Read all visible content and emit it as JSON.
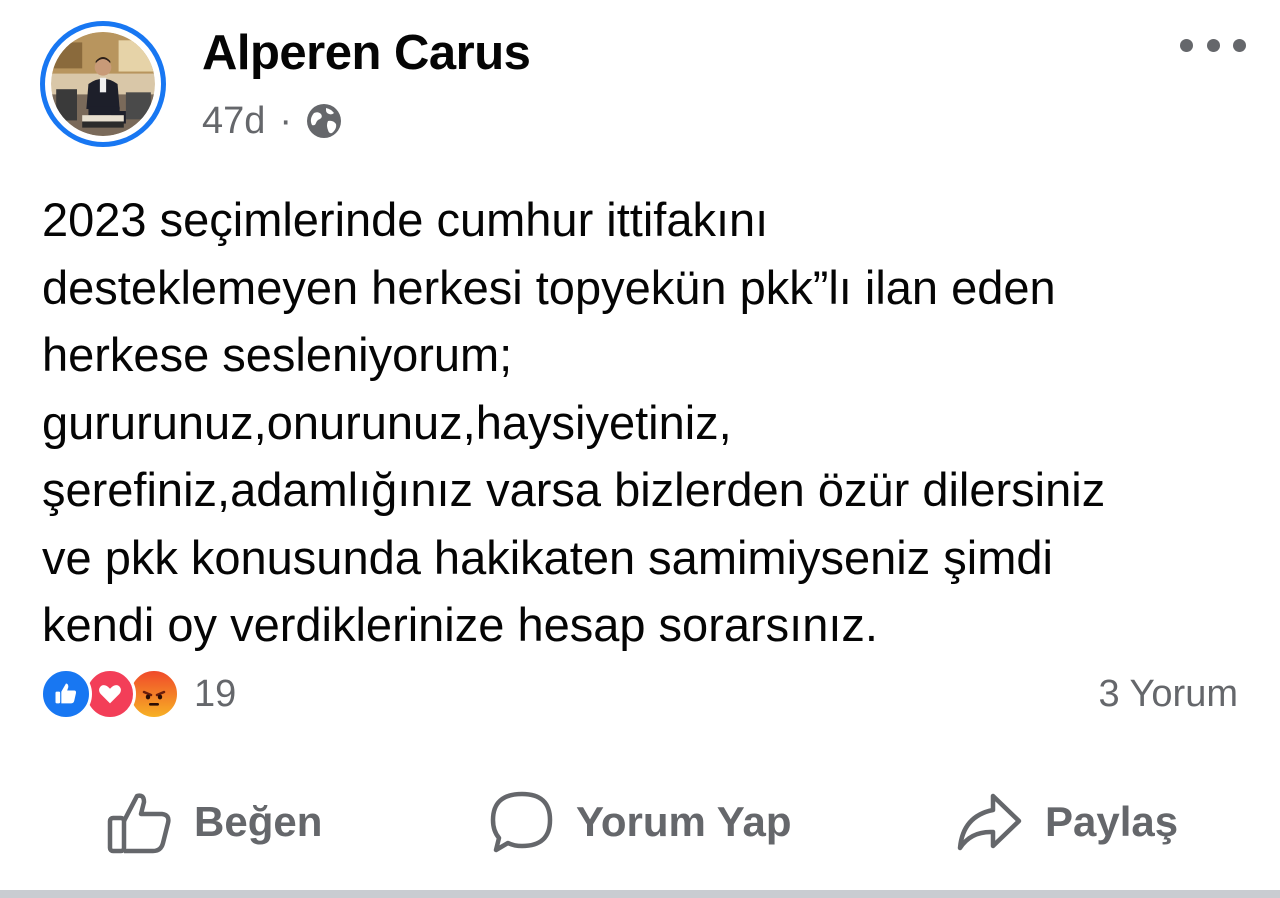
{
  "post": {
    "author": "Alperen Carus",
    "time": "47d",
    "separator": "·",
    "privacy_icon": "globe-icon",
    "text": "2023 seçimlerinde cumhur ittifakını\ndesteklemeyen herkesi topyekün pkk”lı ilan eden\nherkese sesleniyorum;\ngururunuz,onurunuz,haysiyetiniz,\nşerefiniz,adamlığınız varsa bizlerden özür dilersiniz\nve pkk konusunda hakikaten samimiyseniz şimdi\nkendi oy verdiklerinize hesap sorarsınız."
  },
  "reactions": {
    "types": [
      "like",
      "love",
      "angry"
    ],
    "count": "19"
  },
  "comments": {
    "count_label": "3 Yorum"
  },
  "actions": {
    "like_label": "Beğen",
    "comment_label": "Yorum Yap",
    "share_label": "Paylaş"
  },
  "colors": {
    "accent": "#1877f2",
    "secondary_text": "#65676b",
    "love": "#f33e58",
    "angry": "#f7b125"
  }
}
